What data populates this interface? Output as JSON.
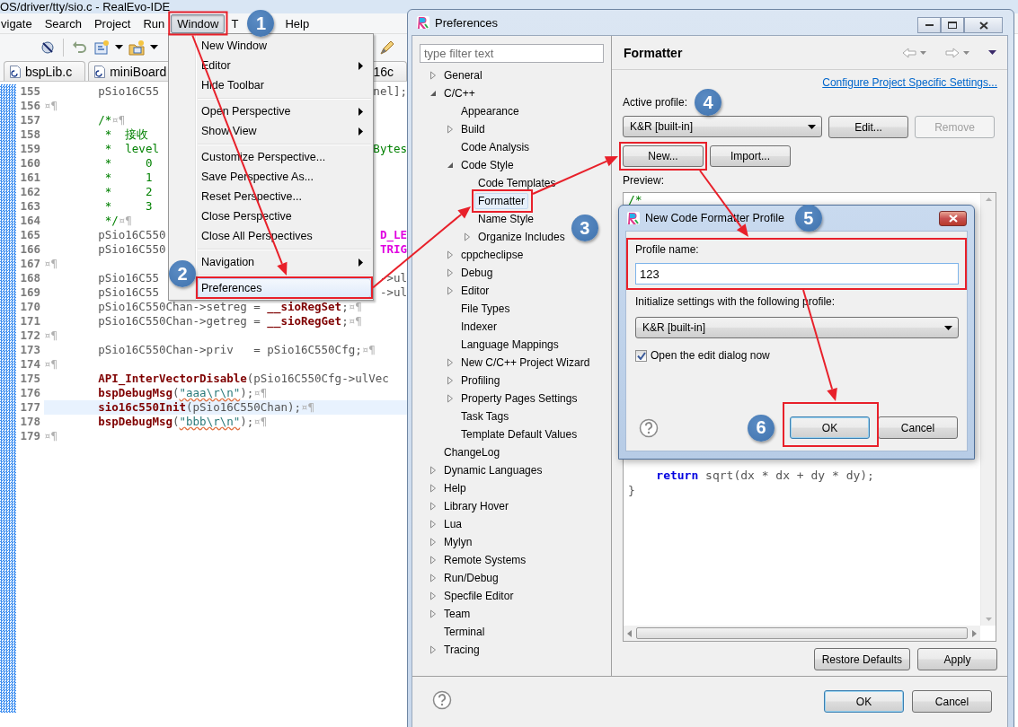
{
  "ide": {
    "title": "OS/driver/tty/sio.c - RealEvo-IDE",
    "menu": [
      {
        "label": "vigate",
        "selected": false
      },
      {
        "label": "Search",
        "selected": false
      },
      {
        "label": "Project",
        "selected": false
      },
      {
        "label": "Run",
        "selected": false
      },
      {
        "label": "Window",
        "selected": true
      },
      {
        "label": "T",
        "selected": false
      },
      {
        "label": "Help",
        "selected": false
      }
    ],
    "tabs": [
      {
        "label": "bspLib.c"
      },
      {
        "label": "miniBoard"
      },
      {
        "label": "16c"
      }
    ],
    "code": [
      {
        "number": "155",
        "current": false,
        "head": [
          {
            "kind": "plain",
            "text": "        pSio16C55"
          }
        ],
        "tail": [
          {
            "kind": "plain",
            "text": "nel];"
          }
        ]
      },
      {
        "number": "156",
        "current": false,
        "head": [
          {
            "kind": "ws",
            "text": "¤¶"
          }
        ]
      },
      {
        "number": "157",
        "current": false,
        "head": [
          {
            "kind": "comment",
            "text": "        /*"
          },
          {
            "kind": "ws",
            "text": "¤¶"
          }
        ]
      },
      {
        "number": "158",
        "current": false,
        "head": [
          {
            "kind": "comment",
            "text": "         *  接收"
          }
        ]
      },
      {
        "number": "159",
        "current": false,
        "head": [
          {
            "kind": "comment",
            "text": "         *  level"
          }
        ],
        "tail": [
          {
            "kind": "comment",
            "text": "Bytes"
          }
        ]
      },
      {
        "number": "160",
        "current": false,
        "head": [
          {
            "kind": "comment",
            "text": "         *     0"
          }
        ]
      },
      {
        "number": "161",
        "current": false,
        "head": [
          {
            "kind": "comment",
            "text": "         *     1"
          }
        ]
      },
      {
        "number": "162",
        "current": false,
        "head": [
          {
            "kind": "comment",
            "text": "         *     2"
          }
        ]
      },
      {
        "number": "163",
        "current": false,
        "head": [
          {
            "kind": "comment",
            "text": "         *     3"
          }
        ]
      },
      {
        "number": "164",
        "current": false,
        "head": [
          {
            "kind": "comment",
            "text": "         */"
          },
          {
            "kind": "ws",
            "text": "¤¶"
          }
        ]
      },
      {
        "number": "165",
        "current": false,
        "head": [
          {
            "kind": "plain",
            "text": "        pSio16C550"
          }
        ],
        "tail": [
          {
            "kind": "macro",
            "text": "D_LE"
          }
        ]
      },
      {
        "number": "166",
        "current": false,
        "head": [
          {
            "kind": "plain",
            "text": "        pSio16C550"
          }
        ],
        "tail": [
          {
            "kind": "macro",
            "text": "TRIG"
          }
        ]
      },
      {
        "number": "167",
        "current": false,
        "head": [
          {
            "kind": "ws",
            "text": "¤¶"
          }
        ]
      },
      {
        "number": "168",
        "current": false,
        "head": [
          {
            "kind": "plain",
            "text": "        pSio16C55"
          }
        ],
        "tail": [
          {
            "kind": "plain",
            "text": "->ul"
          }
        ]
      },
      {
        "number": "169",
        "current": false,
        "head": [
          {
            "kind": "plain",
            "text": "        pSio16C55"
          }
        ],
        "tail": [
          {
            "kind": "plain",
            "text": "->ul"
          }
        ]
      },
      {
        "number": "170",
        "current": false,
        "head": [
          {
            "kind": "plain",
            "text": "        pSio16C550Chan->setreg = "
          },
          {
            "kind": "fn",
            "text": "__sioRegSet"
          },
          {
            "kind": "plain",
            "text": ";"
          },
          {
            "kind": "ws",
            "text": "¤¶"
          }
        ]
      },
      {
        "number": "171",
        "current": false,
        "head": [
          {
            "kind": "plain",
            "text": "        pSio16C550Chan->getreg = "
          },
          {
            "kind": "fn",
            "text": "__sioRegGet"
          },
          {
            "kind": "plain",
            "text": ";"
          },
          {
            "kind": "ws",
            "text": "¤¶"
          }
        ]
      },
      {
        "number": "172",
        "current": false,
        "head": [
          {
            "kind": "ws",
            "text": "¤¶"
          }
        ]
      },
      {
        "number": "173",
        "current": false,
        "head": [
          {
            "kind": "plain",
            "text": "        pSio16C550Chan->priv   = pSio16C550Cfg;"
          },
          {
            "kind": "ws",
            "text": "¤¶"
          }
        ]
      },
      {
        "number": "174",
        "current": false,
        "head": [
          {
            "kind": "ws",
            "text": "¤¶"
          }
        ]
      },
      {
        "number": "175",
        "current": false,
        "head": [
          {
            "kind": "fn",
            "text": "        API_InterVectorDisable"
          },
          {
            "kind": "plain",
            "text": "(pSio16C550Cfg->ulVec"
          }
        ]
      },
      {
        "number": "176",
        "current": false,
        "head": [
          {
            "kind": "fn",
            "text": "        bspDebugMsg"
          },
          {
            "kind": "plain",
            "text": "("
          },
          {
            "kind": "string",
            "text": "\"aaa\\r\\n\""
          },
          {
            "kind": "plain",
            "text": ");"
          },
          {
            "kind": "ws",
            "text": "¤¶"
          }
        ]
      },
      {
        "number": "177",
        "current": true,
        "head": [
          {
            "kind": "fn",
            "text": "        sio16c550Init"
          },
          {
            "kind": "plain",
            "text": "(pSio16C550Chan);"
          },
          {
            "kind": "ws",
            "text": "¤¶"
          }
        ]
      },
      {
        "number": "178",
        "current": false,
        "head": [
          {
            "kind": "fn",
            "text": "        bspDebugMsg"
          },
          {
            "kind": "plain",
            "text": "("
          },
          {
            "kind": "string",
            "text": "\"bbb\\r\\n\""
          },
          {
            "kind": "plain",
            "text": ");"
          },
          {
            "kind": "ws",
            "text": "¤¶"
          }
        ]
      },
      {
        "number": "179",
        "current": false,
        "head": [
          {
            "kind": "ws",
            "text": "¤¶"
          }
        ]
      }
    ]
  },
  "window_menu": [
    {
      "kind": "item",
      "label": "New Window",
      "selected": false
    },
    {
      "kind": "submenu",
      "label": "Editor",
      "selected": false
    },
    {
      "kind": "item",
      "label": "Hide Toolbar",
      "selected": false
    },
    {
      "kind": "separator"
    },
    {
      "kind": "submenu",
      "label": "Open Perspective",
      "selected": false
    },
    {
      "kind": "submenu",
      "label": "Show View",
      "selected": false
    },
    {
      "kind": "separator"
    },
    {
      "kind": "item",
      "label": "Customize Perspective...",
      "selected": false
    },
    {
      "kind": "item",
      "label": "Save Perspective As...",
      "selected": false
    },
    {
      "kind": "item",
      "label": "Reset Perspective...",
      "selected": false
    },
    {
      "kind": "item",
      "label": "Close Perspective",
      "selected": false
    },
    {
      "kind": "item",
      "label": "Close All Perspectives",
      "selected": false
    },
    {
      "kind": "separator"
    },
    {
      "kind": "submenu",
      "label": "Navigation",
      "selected": false
    },
    {
      "kind": "separator"
    },
    {
      "kind": "item",
      "label": "Preferences",
      "selected": true
    }
  ],
  "preferences": {
    "title": "Preferences",
    "filter": {
      "placeholder": "type filter text"
    },
    "tree": [
      {
        "label": "General",
        "kind": "branch",
        "expanded": false,
        "selected": false
      },
      {
        "label": "C/C++",
        "kind": "branch",
        "expanded": true,
        "selected": false,
        "children": [
          {
            "label": "Appearance",
            "kind": "leaf",
            "selected": false
          },
          {
            "label": "Build",
            "kind": "branch",
            "expanded": false,
            "selected": false
          },
          {
            "label": "Code Analysis",
            "kind": "leaf",
            "selected": false
          },
          {
            "label": "Code Style",
            "kind": "branch",
            "expanded": true,
            "selected": false,
            "children": [
              {
                "label": "Code Templates",
                "kind": "leaf",
                "selected": false
              },
              {
                "label": "Formatter",
                "kind": "leaf",
                "selected": true
              },
              {
                "label": "Name Style",
                "kind": "leaf",
                "selected": false
              },
              {
                "label": "Organize Includes",
                "kind": "branch",
                "expanded": false,
                "selected": false
              }
            ]
          },
          {
            "label": "cppcheclipse",
            "kind": "branch",
            "expanded": false,
            "selected": false
          },
          {
            "label": "Debug",
            "kind": "branch",
            "expanded": false,
            "selected": false
          },
          {
            "label": "Editor",
            "kind": "branch",
            "expanded": false,
            "selected": false
          },
          {
            "label": "File Types",
            "kind": "leaf",
            "selected": false
          },
          {
            "label": "Indexer",
            "kind": "leaf",
            "selected": false
          },
          {
            "label": "Language Mappings",
            "kind": "leaf",
            "selected": false
          },
          {
            "label": "New C/C++ Project Wizard",
            "kind": "branch",
            "expanded": false,
            "selected": false
          },
          {
            "label": "Profiling",
            "kind": "branch",
            "expanded": false,
            "selected": false
          },
          {
            "label": "Property Pages Settings",
            "kind": "branch",
            "expanded": false,
            "selected": false
          },
          {
            "label": "Task Tags",
            "kind": "leaf",
            "selected": false
          },
          {
            "label": "Template Default Values",
            "kind": "leaf",
            "selected": false
          }
        ]
      },
      {
        "label": "ChangeLog",
        "kind": "leaf",
        "selected": false
      },
      {
        "label": "Dynamic Languages",
        "kind": "branch",
        "expanded": false,
        "selected": false
      },
      {
        "label": "Help",
        "kind": "branch",
        "expanded": false,
        "selected": false
      },
      {
        "label": "Library Hover",
        "kind": "branch",
        "expanded": false,
        "selected": false
      },
      {
        "label": "Lua",
        "kind": "branch",
        "expanded": false,
        "selected": false
      },
      {
        "label": "Mylyn",
        "kind": "branch",
        "expanded": false,
        "selected": false
      },
      {
        "label": "Remote Systems",
        "kind": "branch",
        "expanded": false,
        "selected": false
      },
      {
        "label": "Run/Debug",
        "kind": "branch",
        "expanded": false,
        "selected": false
      },
      {
        "label": "Specfile Editor",
        "kind": "branch",
        "expanded": false,
        "selected": false
      },
      {
        "label": "Team",
        "kind": "branch",
        "expanded": false,
        "selected": false
      },
      {
        "label": "Terminal",
        "kind": "leaf",
        "selected": false
      },
      {
        "label": "Tracing",
        "kind": "branch",
        "expanded": false,
        "selected": false
      }
    ],
    "page": {
      "heading": "Formatter",
      "link": "Configure Project Specific Settings...",
      "profile_label": "Active profile:",
      "profile": "K&R [built-in]",
      "profile_buttons": [
        {
          "label": "Edit...",
          "disabled": false
        },
        {
          "label": "Remove",
          "disabled": true
        }
      ],
      "buttons": [
        {
          "label": "New...",
          "disabled": false
        },
        {
          "label": "Import...",
          "disabled": false
        }
      ],
      "preview_label": "Preview:",
      "preview_top": [
        [
          {
            "kind": "comment",
            "text": "/*"
          }
        ]
      ],
      "preview_bottom": [
        [
          {
            "kind": "keyword",
            "text": "    return"
          },
          {
            "kind": "plain",
            "text": " sqrt(dx * dx + dy * dy);"
          }
        ],
        [
          {
            "kind": "plain",
            "text": "}"
          }
        ]
      ],
      "page_buttons": [
        {
          "label": "Restore Defaults"
        },
        {
          "label": "Apply"
        }
      ]
    },
    "footer_buttons": [
      {
        "label": "OK",
        "default": true
      },
      {
        "label": "Cancel",
        "default": false
      }
    ]
  },
  "dialog": {
    "title": "New Code Formatter Profile",
    "name_label": "Profile name:",
    "name_value": "123",
    "init_label": "Initialize settings with the following profile:",
    "init_profile": "K&R [built-in]",
    "open_edit": {
      "label": "Open the edit dialog now",
      "checked": true
    },
    "buttons": [
      {
        "label": "OK",
        "default": true
      },
      {
        "label": "Cancel",
        "default": false
      }
    ]
  },
  "steps": [
    {
      "label": "1"
    },
    {
      "label": "2"
    },
    {
      "label": "3"
    },
    {
      "label": "4"
    },
    {
      "label": "5"
    },
    {
      "label": "6"
    }
  ]
}
